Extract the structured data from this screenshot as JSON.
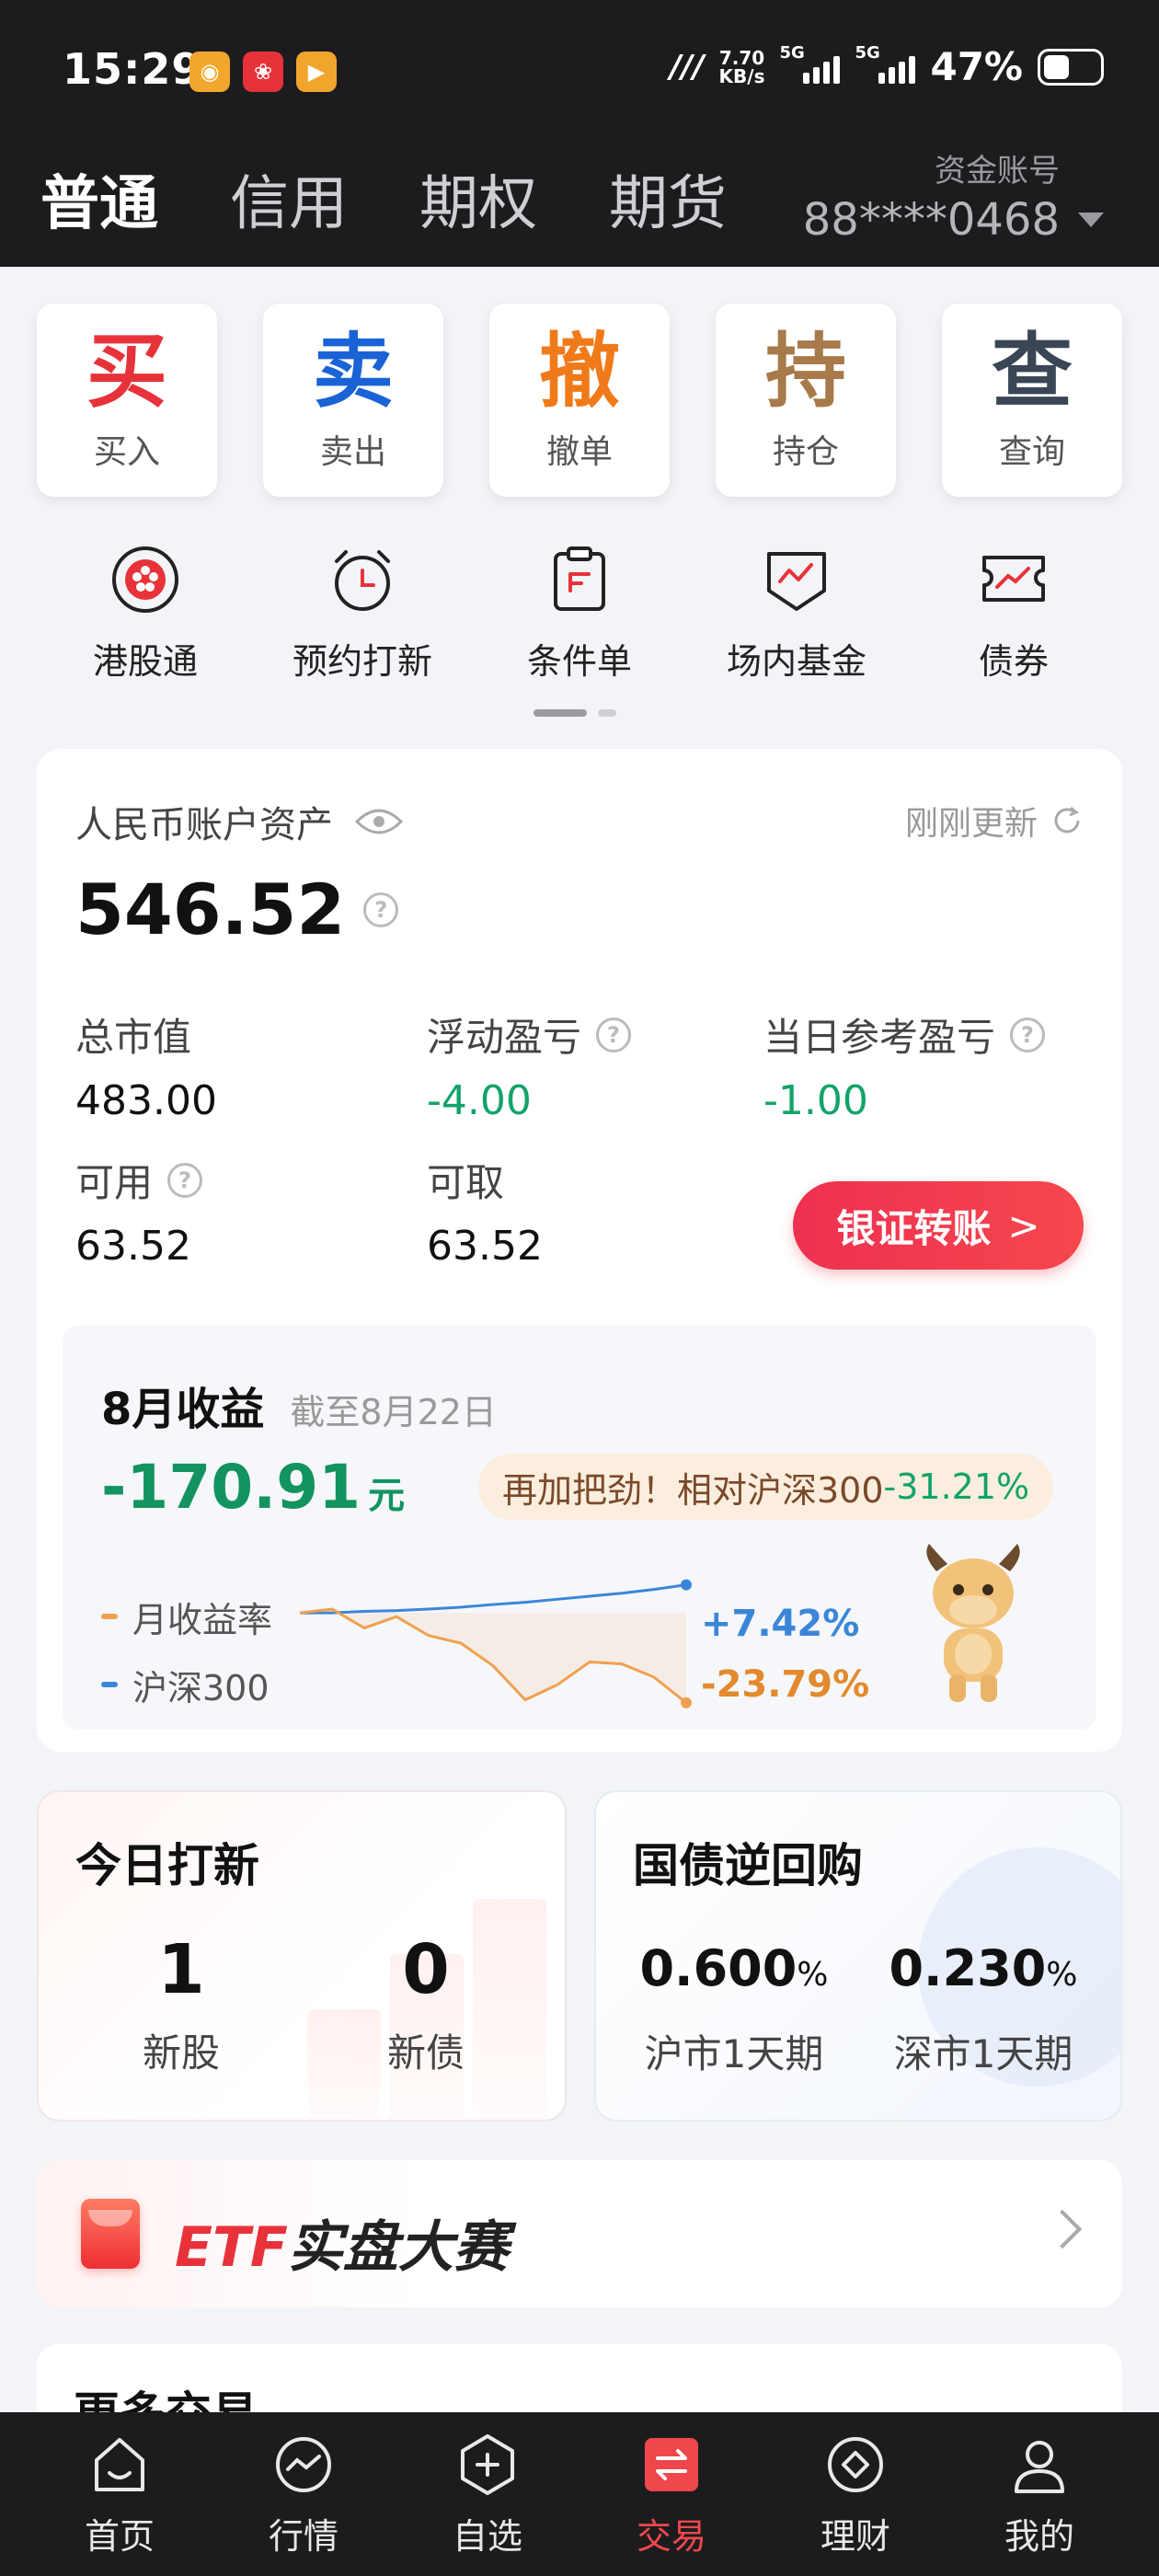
{
  "status_bar": {
    "time": "15:29",
    "speed_value": "7.70",
    "speed_unit": "KB/s",
    "net1": "5G",
    "net2": "5G",
    "battery": "47%",
    "battery_level": 0.47
  },
  "header": {
    "tabs": [
      "普通",
      "信用",
      "期权",
      "期货"
    ],
    "account_label": "资金账号",
    "account_number": "88****0468"
  },
  "quick_actions": [
    {
      "big": "买",
      "label": "买入",
      "color": "#e8323a"
    },
    {
      "big": "卖",
      "label": "卖出",
      "color": "#1a63d6"
    },
    {
      "big": "撤",
      "label": "撤单",
      "color": "#f07a1a"
    },
    {
      "big": "持",
      "label": "持仓",
      "color": "#a8794a"
    },
    {
      "big": "查",
      "label": "查询",
      "color": "#3a4656"
    }
  ],
  "feature_icons": [
    {
      "label": "港股通",
      "icon": "hk-flower-icon"
    },
    {
      "label": "预约打新",
      "icon": "alarm-clock-icon"
    },
    {
      "label": "条件单",
      "icon": "clipboard-icon"
    },
    {
      "label": "场内基金",
      "icon": "fund-shield-icon"
    },
    {
      "label": "债券",
      "icon": "bond-ticket-icon"
    }
  ],
  "assets": {
    "title": "人民币账户资产",
    "updated": "刚刚更新",
    "total": "546.52",
    "market_value_label": "总市值",
    "market_value": "483.00",
    "floating_pl_label": "浮动盈亏",
    "floating_pl": "-4.00",
    "daily_pl_label": "当日参考盈亏",
    "daily_pl": "-1.00",
    "available_label": "可用",
    "available": "63.52",
    "withdrawable_label": "可取",
    "withdrawable": "63.52",
    "transfer_button": "银证转账"
  },
  "monthly": {
    "title": "8月收益",
    "as_of": "截至8月22日",
    "value": "-170.91",
    "unit": "元",
    "badge_text": "再加把劲！相对沪深300",
    "badge_value": "-31.21%",
    "legend_monthly": "月收益率",
    "legend_index": "沪深300",
    "index_value": "+7.42%",
    "monthly_value": "-23.79%",
    "colors": {
      "monthly": "#f0a050",
      "index": "#3b86d8"
    }
  },
  "chart_data": {
    "type": "line",
    "series": [
      {
        "name": "沪深300",
        "values": [
          0,
          0,
          0.4,
          0.6,
          1.0,
          1.5,
          2.2,
          2.8,
          3.6,
          4.4,
          5.2,
          6.2,
          7.42
        ]
      },
      {
        "name": "月收益率",
        "values": [
          0,
          1.0,
          -4,
          -1.0,
          -6,
          -8,
          -14,
          -23,
          -19,
          -13,
          -13.5,
          -17,
          -23.79
        ]
      }
    ],
    "ylim": [
      -26,
      10
    ]
  },
  "ipo_card": {
    "title": "今日打新",
    "stocks_count": "1",
    "stocks_label": "新股",
    "bonds_count": "0",
    "bonds_label": "新债"
  },
  "repo_card": {
    "title": "国债逆回购",
    "sh_rate": "0.600",
    "sh_label": "沪市1天期",
    "sz_rate": "0.230",
    "sz_label": "深市1天期",
    "percent": "%"
  },
  "etf_banner": {
    "prefix": "ETF",
    "suffix": "实盘大赛"
  },
  "more_trading": {
    "title": "更多交易"
  },
  "bottom_nav": [
    "首页",
    "行情",
    "自选",
    "交易",
    "理财",
    "我的"
  ]
}
